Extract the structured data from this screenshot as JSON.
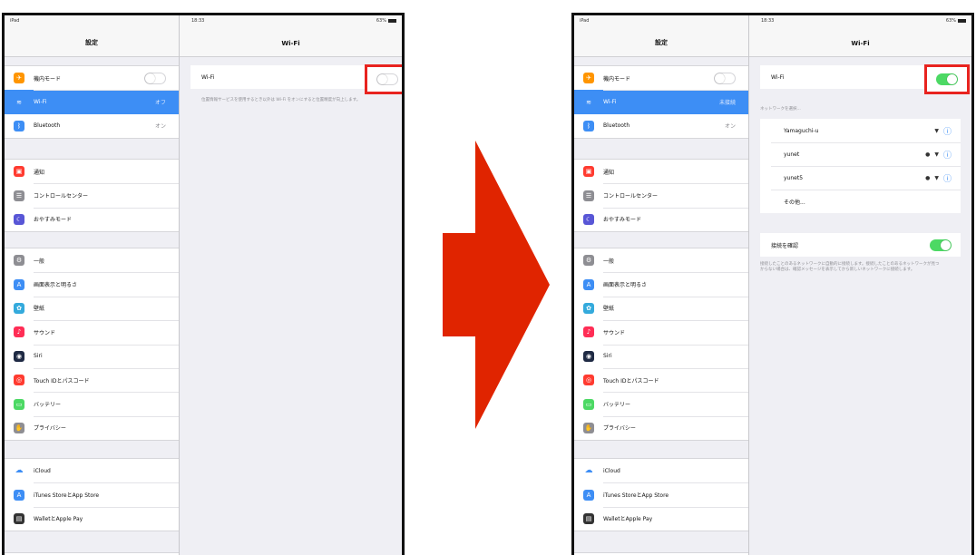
{
  "colors": {
    "accent": "#3d8ef5",
    "toggle_on": "#4cd964",
    "highlight": "#e8231f",
    "arrow": "#e02400"
  },
  "statusbar": {
    "device": "iPad",
    "time": "18:33",
    "battery": "63%"
  },
  "sidebar": {
    "title": "設定",
    "group1": [
      {
        "label": "機内モード",
        "icon": "airplane-icon",
        "color": "#ff9500"
      },
      {
        "label": "Wi-Fi",
        "icon": "wifi-icon",
        "color": "#3d8ef5"
      },
      {
        "label": "Bluetooth",
        "icon": "bluetooth-icon",
        "color": "#3d8ef5",
        "value": "オン"
      }
    ],
    "group2": [
      {
        "label": "通知",
        "icon": "notifications-icon",
        "color": "#ff3b30"
      },
      {
        "label": "コントロールセンター",
        "icon": "control-center-icon",
        "color": "#8e8e93"
      },
      {
        "label": "おやすみモード",
        "icon": "moon-icon",
        "color": "#5856d6"
      }
    ],
    "group3": [
      {
        "label": "一般",
        "icon": "gear-icon",
        "color": "#8e8e93"
      },
      {
        "label": "画面表示と明るさ",
        "icon": "display-icon",
        "color": "#3d8ef5"
      },
      {
        "label": "壁紙",
        "icon": "wallpaper-icon",
        "color": "#34aadc"
      },
      {
        "label": "サウンド",
        "icon": "sound-icon",
        "color": "#ff2d55"
      },
      {
        "label": "Siri",
        "icon": "siri-icon",
        "color": "#1f2a44"
      },
      {
        "label": "Touch IDとパスコード",
        "icon": "fingerprint-icon",
        "color": "#ff3b30"
      },
      {
        "label": "バッテリー",
        "icon": "battery-icon",
        "color": "#4cd964"
      },
      {
        "label": "プライバシー",
        "icon": "hand-icon",
        "color": "#8e8e93"
      }
    ],
    "group4": [
      {
        "label": "iCloud",
        "icon": "cloud-icon",
        "color": "#ffffff"
      },
      {
        "label": "iTunes StoreとApp Store",
        "icon": "app-store-icon",
        "color": "#3d8ef5"
      },
      {
        "label": "WalletとApple Pay",
        "icon": "wallet-icon",
        "color": "#333333"
      }
    ],
    "wifi_value_off": "オフ",
    "wifi_value_on": "未接続"
  },
  "detail": {
    "title": "Wi-Fi",
    "wifi_label": "Wi-Fi",
    "wifi_off_note": "位置情報サービスを使用するとき以外は Wi-Fi をオンにすると位置精度が向上します。",
    "networks_header": "ネットワークを選択...",
    "networks": [
      {
        "name": "Yamaguchi-u",
        "secure": false
      },
      {
        "name": "yunet",
        "secure": true
      },
      {
        "name": "yunet5",
        "secure": true
      }
    ],
    "other": "その他...",
    "ask_label": "接続を確認",
    "ask_note": "接続したことのあるネットワークに自動的に接続します。接続したことのあるネットワークが見つからない場合は、確認メッセージを表示してから新しいネットワークに接続します。",
    "left_toggle_on": false,
    "right_toggle_on": true,
    "ask_toggle_on": true
  }
}
